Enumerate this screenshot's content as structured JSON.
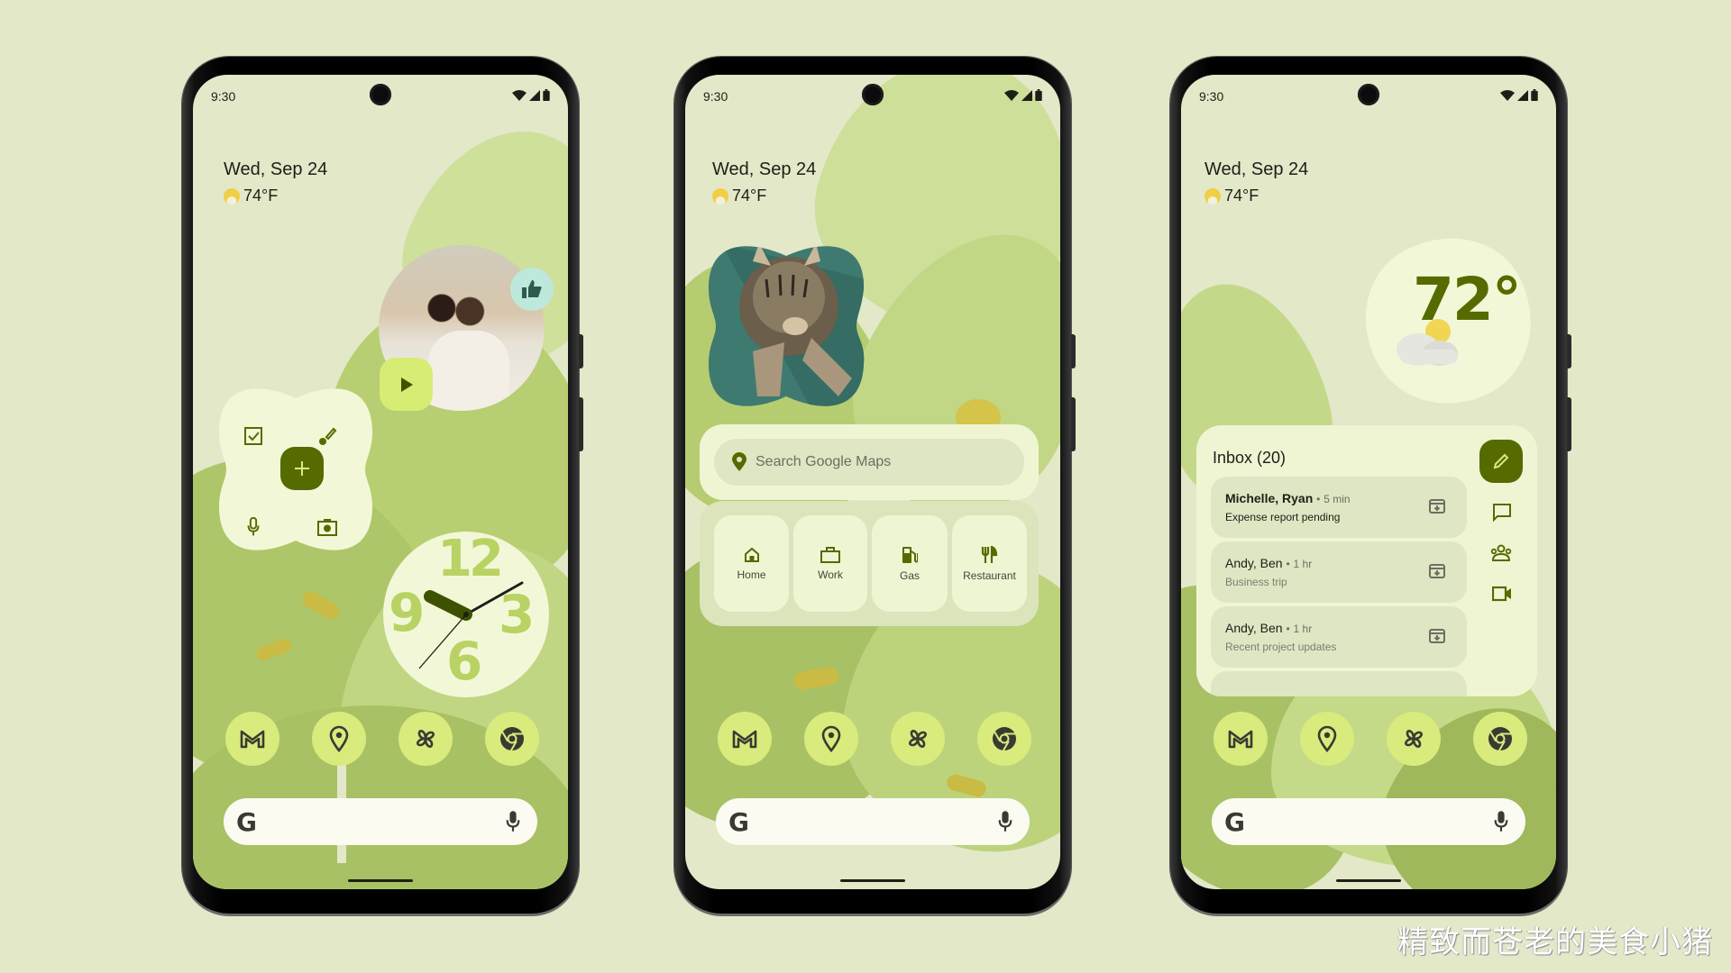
{
  "colors": {
    "background": "#e3e8c9",
    "accent_dark": "#556b00",
    "accent_light": "#d8eb7c",
    "surface": "#eff5d3",
    "surface_variant": "#dfe6c3",
    "clock_numerals": "#b9d264",
    "thumb_badge": "#bfe8dc"
  },
  "phones": [
    {
      "status": {
        "time": "9:30",
        "icons": [
          "wifi-icon",
          "signal-icon",
          "battery-icon"
        ]
      },
      "glance": {
        "date": "Wed, Sep 24",
        "temperature": "74°F",
        "weather_icon": "partly-sunny-icon"
      },
      "media_widget": {
        "badge_icon": "thumbs-up-icon",
        "action_icon": "play-icon"
      },
      "quick_actions": {
        "icons": [
          "checkbox-icon",
          "brush-icon",
          "mic-icon",
          "camera-icon"
        ],
        "center_icon": "plus-icon"
      },
      "clock": {
        "numerals": [
          "12",
          "3",
          "6",
          "9"
        ],
        "time": "10:09"
      },
      "dock": [
        "gmail-icon",
        "maps-icon",
        "pinwheel-icon",
        "chrome-icon"
      ],
      "search": {
        "logo": "G",
        "mic_icon": "mic-icon"
      }
    },
    {
      "status": {
        "time": "9:30",
        "icons": [
          "wifi-icon",
          "signal-icon",
          "battery-icon"
        ]
      },
      "glance": {
        "date": "Wed, Sep 24",
        "temperature": "74°F",
        "weather_icon": "partly-sunny-icon"
      },
      "photo_widget": {
        "subject": "sleeping kitten"
      },
      "maps_widget": {
        "search_placeholder": "Search Google Maps",
        "shortcuts": [
          {
            "label": "Home",
            "icon": "home-icon"
          },
          {
            "label": "Work",
            "icon": "briefcase-icon"
          },
          {
            "label": "Gas",
            "icon": "gas-station-icon"
          },
          {
            "label": "Restaurant",
            "icon": "restaurant-icon"
          }
        ]
      },
      "dock": [
        "gmail-icon",
        "maps-icon",
        "pinwheel-icon",
        "chrome-icon"
      ],
      "search": {
        "logo": "G",
        "mic_icon": "mic-icon"
      }
    },
    {
      "status": {
        "time": "9:30",
        "icons": [
          "wifi-icon",
          "signal-icon",
          "battery-icon"
        ]
      },
      "glance": {
        "date": "Wed, Sep 24",
        "temperature": "74°F",
        "weather_icon": "partly-sunny-icon"
      },
      "weather_widget": {
        "temperature": "72°",
        "icon": "partly-cloudy-icon"
      },
      "inbox_widget": {
        "title": "Inbox (20)",
        "messages": [
          {
            "from": "Michelle, Ryan",
            "time": "5 min",
            "subject": "Expense report pending",
            "unread": true
          },
          {
            "from": "Andy, Ben",
            "time": "1 hr",
            "subject": "Business trip",
            "unread": false
          },
          {
            "from": "Andy, Ben",
            "time": "1 hr",
            "subject": "Recent project updates",
            "unread": false
          }
        ],
        "side_actions": [
          "compose-icon",
          "chat-icon",
          "meet-group-icon",
          "video-icon"
        ]
      },
      "dock": [
        "gmail-icon",
        "maps-icon",
        "pinwheel-icon",
        "chrome-icon"
      ],
      "search": {
        "logo": "G",
        "mic_icon": "mic-icon"
      }
    }
  ],
  "watermark": "精致而苍老的美食小猪",
  "separator": "•"
}
